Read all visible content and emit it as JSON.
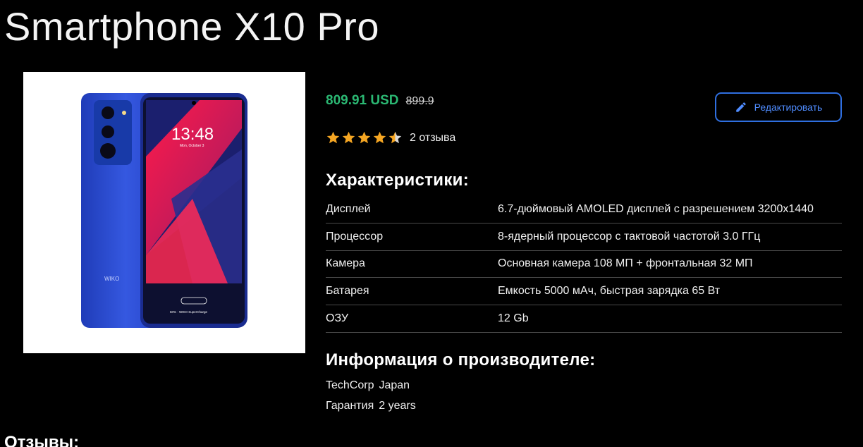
{
  "product": {
    "title": "Smartphone X10 Pro",
    "price_current": "809.91 USD",
    "price_old": "899.9",
    "rating": 4.5,
    "rating_max": 5,
    "reviews_count_label": "2 отзыва",
    "image": {
      "time": "13:48",
      "date": "Mon, October 3",
      "brand": "WIKO",
      "phone_color": "#2a4fd0",
      "footer": "60% · WIKO SuperCharge"
    }
  },
  "toolbar": {
    "edit_label": "Редактировать"
  },
  "specs": {
    "heading": "Характеристики:",
    "rows": [
      {
        "name": "Дисплей",
        "value": "6.7-дюймовый AMOLED дисплей с разрешением 3200x1440"
      },
      {
        "name": "Процессор",
        "value": "8-ядерный процессор с тактовой частотой 3.0 ГГц"
      },
      {
        "name": "Камера",
        "value": "Основная камера 108 МП + фронтальная 32 МП"
      },
      {
        "name": "Батарея",
        "value": "Емкость 5000 мАч, быстрая зарядка 65 Вт"
      },
      {
        "name": "ОЗУ",
        "value": "12 Gb"
      }
    ]
  },
  "manufacturer": {
    "heading": "Информация о производителе:",
    "name": "TechCorp",
    "country": "Japan",
    "warranty_label": "Гарантия",
    "warranty_value": "2 years"
  },
  "reviews": {
    "heading": "Отзывы:"
  },
  "colors": {
    "price_green": "#2bb873",
    "accent_blue": "#2f6fe0",
    "star_orange": "#f5a623"
  }
}
